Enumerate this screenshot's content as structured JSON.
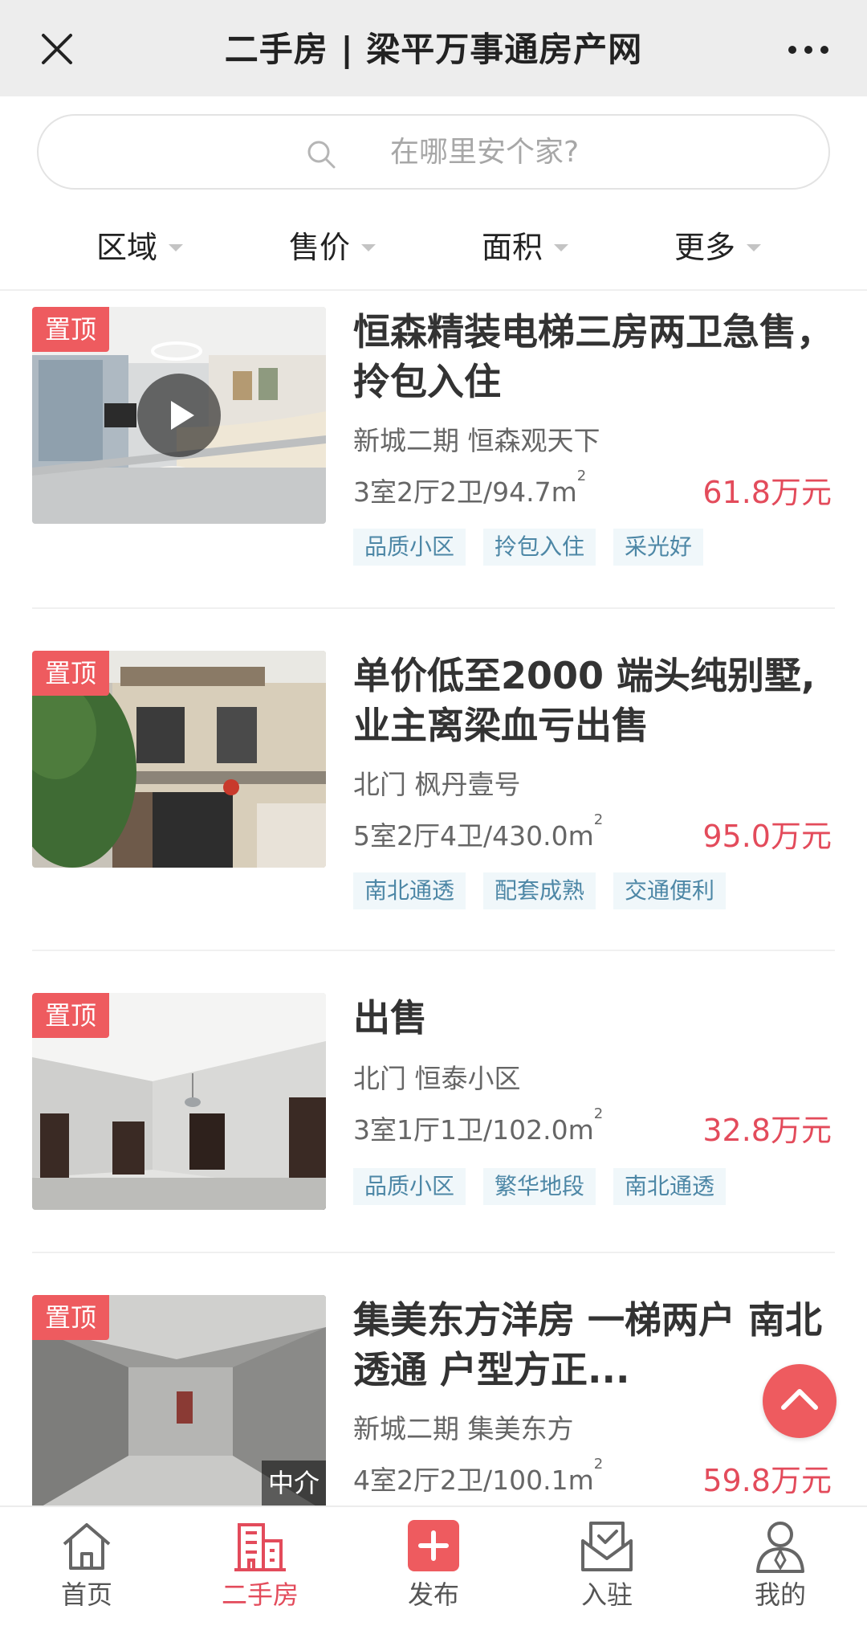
{
  "header": {
    "title": "二手房 | 梁平万事通房产网"
  },
  "search": {
    "placeholder": "在哪里安个家?"
  },
  "filters": [
    {
      "label": "区域"
    },
    {
      "label": "售价"
    },
    {
      "label": "面积"
    },
    {
      "label": "更多"
    }
  ],
  "listings": [
    {
      "badge": "置顶",
      "title_line1": "恒森精装电梯三房两卫急售，",
      "title_line2": "拎包入住",
      "location": "新城二期 恒森观天下",
      "spec": "3室2厅2卫/94.7m",
      "spec_unit_sup": "2",
      "price": "61.8万元",
      "tags": [
        "品质小区",
        "拎包入住",
        "采光好"
      ],
      "has_video": true
    },
    {
      "badge": "置顶",
      "title_line1": "单价低至2000 端头纯别墅,",
      "title_line2": "业主离梁血亏出售",
      "location": "北门 枫丹壹号",
      "spec": "5室2厅4卫/430.0m",
      "spec_unit_sup": "2",
      "price": "95.0万元",
      "tags": [
        "南北通透",
        "配套成熟",
        "交通便利"
      ]
    },
    {
      "badge": "置顶",
      "title_line1": "出售",
      "location": "北门 恒泰小区",
      "spec": "3室1厅1卫/102.0m",
      "spec_unit_sup": "2",
      "price": "32.8万元",
      "tags": [
        "品质小区",
        "繁华地段",
        "南北通透"
      ]
    },
    {
      "badge": "置顶",
      "agent_badge": "中介",
      "title_line1": "集美东方洋房 一梯两户 南北",
      "title_line2": "透通 户型方正...",
      "location": "新城二期 集美东方",
      "spec": "4室2厅2卫/100.1m",
      "spec_unit_sup": "2",
      "price": "59.8万元"
    }
  ],
  "bottom_nav": [
    {
      "label": "首页",
      "icon": "home-icon"
    },
    {
      "label": "二手房",
      "icon": "building-icon",
      "active": true
    },
    {
      "label": "发布",
      "icon": "plus-icon"
    },
    {
      "label": "入驻",
      "icon": "check-envelope-icon"
    },
    {
      "label": "我的",
      "icon": "person-icon"
    }
  ],
  "colors": {
    "accent": "#e34b5b",
    "badge": "#ee5b5f",
    "tag_text": "#4d87a6",
    "tag_bg": "#f0f7fa"
  }
}
